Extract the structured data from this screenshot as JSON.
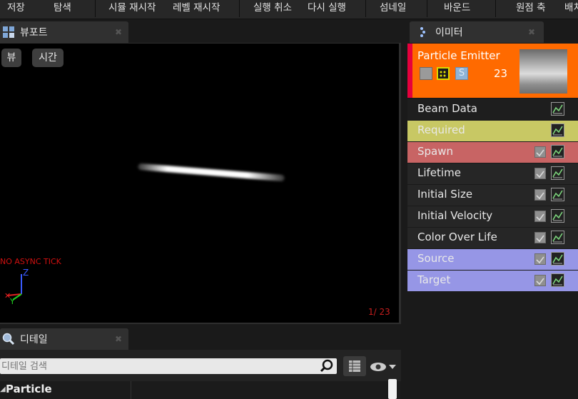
{
  "toolbar": {
    "items": [
      "저장",
      "탐색",
      "시뮬 재시작",
      "레벨 재시작",
      "실행 취소",
      "다시 실행",
      "섬네일",
      "바운드",
      "원점 축",
      "배치"
    ]
  },
  "viewport": {
    "tab_label": "뷰포트",
    "view_button": "뷰",
    "time_button": "시간",
    "warning": "NO ASYNC TICK",
    "axis_label": "Z",
    "frame_counter": "1/  23"
  },
  "details": {
    "tab_label": "디테일",
    "search_placeholder": "디테일 검색",
    "category": "Particle"
  },
  "emitters": {
    "tab_label": "이미터",
    "emitter_name": "Particle Emitter",
    "particle_count": "23",
    "modules": [
      {
        "label": "Beam Data",
        "color": "#1e1e1e",
        "checkbox": false
      },
      {
        "label": "Required",
        "color": "#c8c864",
        "checkbox": false
      },
      {
        "label": "Spawn",
        "color": "#c86464",
        "checkbox": true
      },
      {
        "label": "Lifetime",
        "color": "#262626",
        "checkbox": true
      },
      {
        "label": "Initial Size",
        "color": "#262626",
        "checkbox": true
      },
      {
        "label": "Initial Velocity",
        "color": "#262626",
        "checkbox": true
      },
      {
        "label": "Color Over Life",
        "color": "#262626",
        "checkbox": true
      },
      {
        "label": "Source",
        "color": "#9696e6",
        "checkbox": true
      },
      {
        "label": "Target",
        "color": "#9696e6",
        "checkbox": true
      }
    ]
  },
  "colors": {
    "emitter_header": "#ff6a00",
    "emitter_stripe": "#e6003c"
  }
}
